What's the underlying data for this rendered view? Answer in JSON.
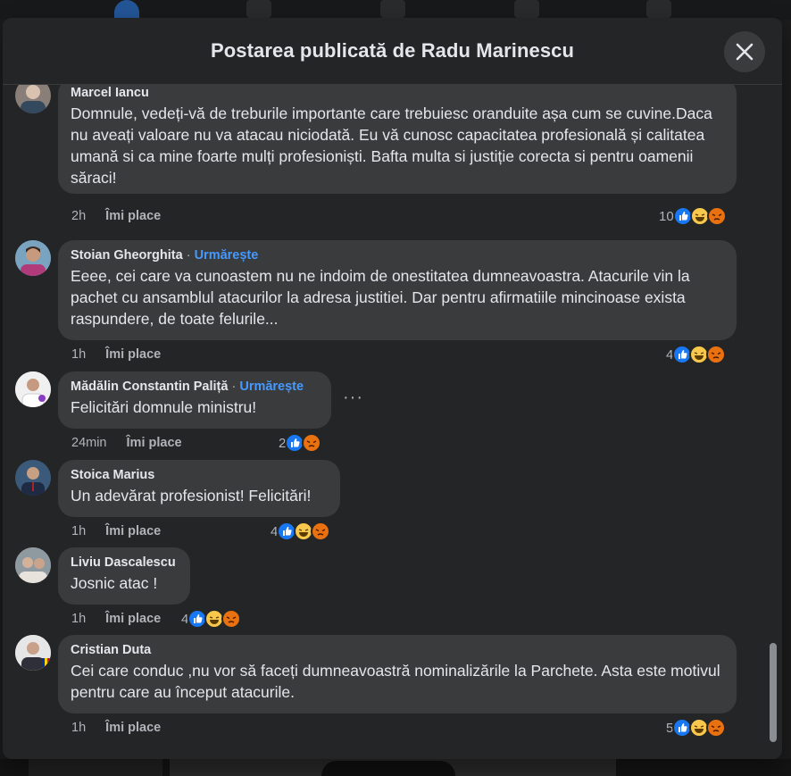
{
  "dialog": {
    "title": "Postarea publicată de Radu Marinescu"
  },
  "icons": {
    "close": "close-icon",
    "like": "like-reaction-icon",
    "haha": "haha-reaction-icon",
    "angry": "angry-reaction-icon",
    "more": "more-options-icon"
  },
  "colors": {
    "dialog_bg": "#242526",
    "bubble_bg": "#3a3b3c",
    "follow_link": "#4599ff",
    "like_blue": "#1877f2"
  },
  "comments": [
    {
      "name": "Marcel Iancu",
      "follow": "",
      "text": "Domnule, vedeți-vă de treburile importante care trebuiesc oranduite așa cum se cuvine.Daca nu aveați valoare nu va atacau niciodată. Eu vă cunosc capacitatea profesională și calitatea umană si ca mine foarte mulți profesioniști. Bafta multa si justiție corecta si pentru oamenii săraci!",
      "time": "2h",
      "like_label": "Îmi place",
      "reaction_count": "10",
      "reactions": [
        "like",
        "haha",
        "angry"
      ]
    },
    {
      "name": "Stoian Gheorghita",
      "follow": "Urmărește",
      "text": "Eeee, cei care va cunoastem nu ne indoim de onestitatea dumneavoastra. Atacurile vin la pachet cu ansamblul atacurilor la adresa justitiei. Dar pentru afirmatiile mincinoase exista raspundere, de toate felurile...",
      "time": "1h",
      "like_label": "Îmi place",
      "reaction_count": "4",
      "reactions": [
        "like",
        "haha",
        "angry"
      ]
    },
    {
      "name": "Mădălin Constantin Paliță",
      "follow": "Urmărește",
      "text": "Felicitări domnule ministru!",
      "time": "24min",
      "like_label": "Îmi place",
      "reaction_count": "2",
      "reactions": [
        "like",
        "angry"
      ],
      "more": "···"
    },
    {
      "name": "Stoica Marius",
      "follow": "",
      "text": "Un adevărat profesionist! Felicitări!",
      "time": "1h",
      "like_label": "Îmi place",
      "reaction_count": "4",
      "reactions": [
        "like",
        "haha",
        "angry"
      ]
    },
    {
      "name": "Liviu Dascalescu",
      "follow": "",
      "text": "Josnic atac !",
      "time": "1h",
      "like_label": "Îmi place",
      "reaction_count": "4",
      "reactions": [
        "like",
        "haha",
        "angry"
      ]
    },
    {
      "name": "Cristian Duta",
      "follow": "",
      "text": "Cei care conduc ,nu vor să faceți dumneavoastră nominalizările la Parchete. Asta este motivul pentru care au început atacurile.",
      "time": "1h",
      "like_label": "Îmi place",
      "reaction_count": "5",
      "reactions": [
        "like",
        "haha",
        "angry"
      ]
    }
  ]
}
